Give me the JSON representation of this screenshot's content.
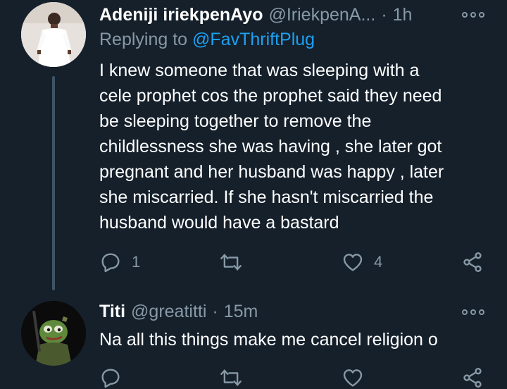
{
  "tweets": [
    {
      "display_name": "Adeniji iriekpenAyo",
      "handle": "@IriekpenA...",
      "separator": "·",
      "time": "1h",
      "reply_prefix": "Replying to ",
      "reply_mention": "@FavThriftPlug",
      "text": "I knew someone that was sleeping with a\ncele prophet cos the prophet said they need\nbe sleeping together to remove the\nchildlessness she was having , she later got\npregnant and her husband was happy , later\nshe miscarried. If she hasn't miscarried the\nhusband would have a bastard",
      "reply_count": "1",
      "retweet_count": "",
      "like_count": "4"
    },
    {
      "display_name": "Titi",
      "handle": "@greatitti",
      "separator": "·",
      "time": "15m",
      "text": "Na all this things make me cancel religion o",
      "reply_count": "",
      "retweet_count": "",
      "like_count": ""
    }
  ],
  "icons": {
    "reply": "reply-bubble-icon",
    "retweet": "retweet-icon",
    "like": "heart-icon",
    "share": "share-icon",
    "more": "more-dots-icon"
  },
  "colors": {
    "background": "#15202b",
    "text": "#ffffff",
    "secondary": "#8899a6",
    "link": "#1da1f2",
    "thread_line": "#3d5466"
  }
}
